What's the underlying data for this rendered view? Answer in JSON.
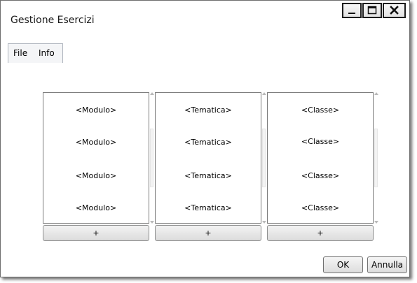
{
  "window": {
    "title": "Gestione Esercizi"
  },
  "menu": {
    "items": [
      "File",
      "Info"
    ]
  },
  "columns": [
    {
      "items": [
        "<Modulo>",
        "<Modulo>",
        "<Modulo>",
        "<Modulo>"
      ],
      "add_label": "+"
    },
    {
      "items": [
        "<Tematica>",
        "<Tematica>",
        "<Tematica>",
        "<Tematica>"
      ],
      "add_label": "+"
    },
    {
      "items": [
        "<Classe>",
        "<Classe>",
        "<Classe>",
        "<Classe>"
      ],
      "add_label": "+"
    }
  ],
  "footer": {
    "ok_label": "OK",
    "cancel_label": "Annulla"
  },
  "icons": {
    "minimize": "minimize-icon",
    "maximize": "maximize-icon",
    "close": "close-icon"
  }
}
